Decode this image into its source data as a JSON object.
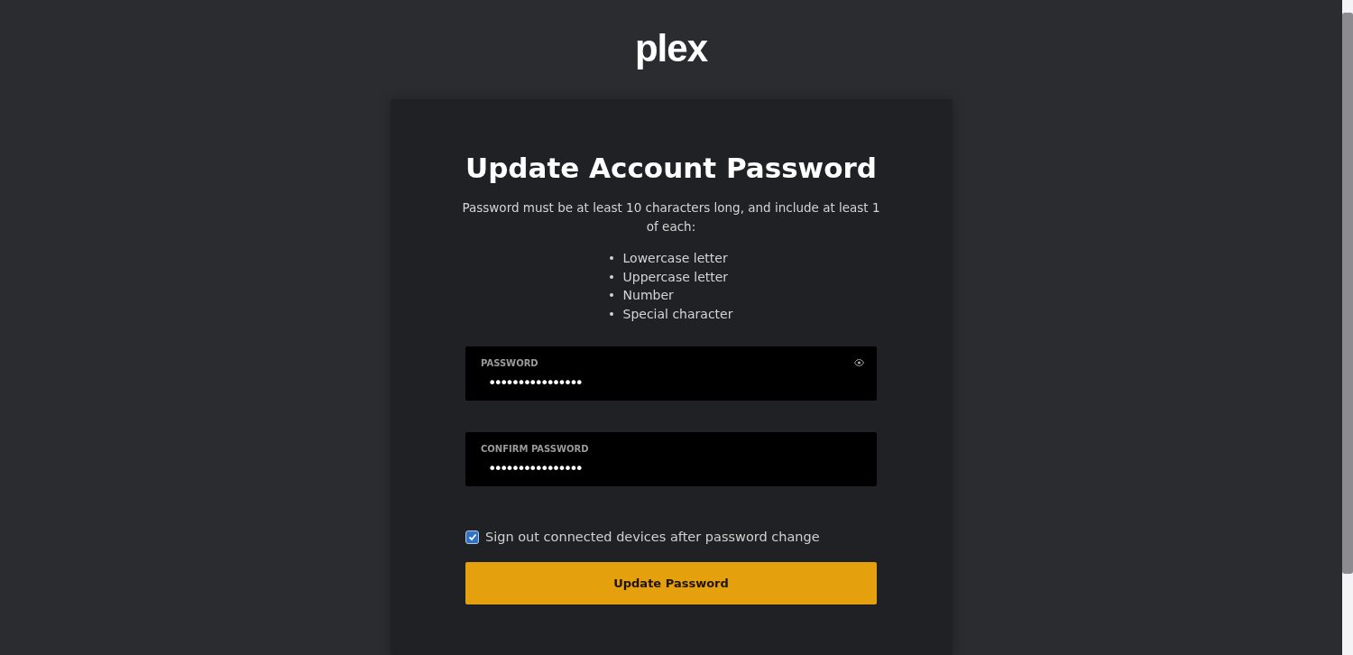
{
  "logo": {
    "text": "plex"
  },
  "card": {
    "title": "Update Account Password",
    "description": "Password must be at least 10 characters long, and include at least 1 of each:",
    "requirements": [
      "Lowercase letter",
      "Uppercase letter",
      "Number",
      "Special character"
    ],
    "fields": [
      {
        "label": "PASSWORD",
        "value": "••••••••••••••••",
        "reveal_icon": true
      },
      {
        "label": "CONFIRM PASSWORD",
        "value": "••••••••••••••••",
        "reveal_icon": false
      }
    ],
    "checkbox": {
      "label": "Sign out connected devices after password change",
      "checked": true
    },
    "button": "Update Password"
  }
}
